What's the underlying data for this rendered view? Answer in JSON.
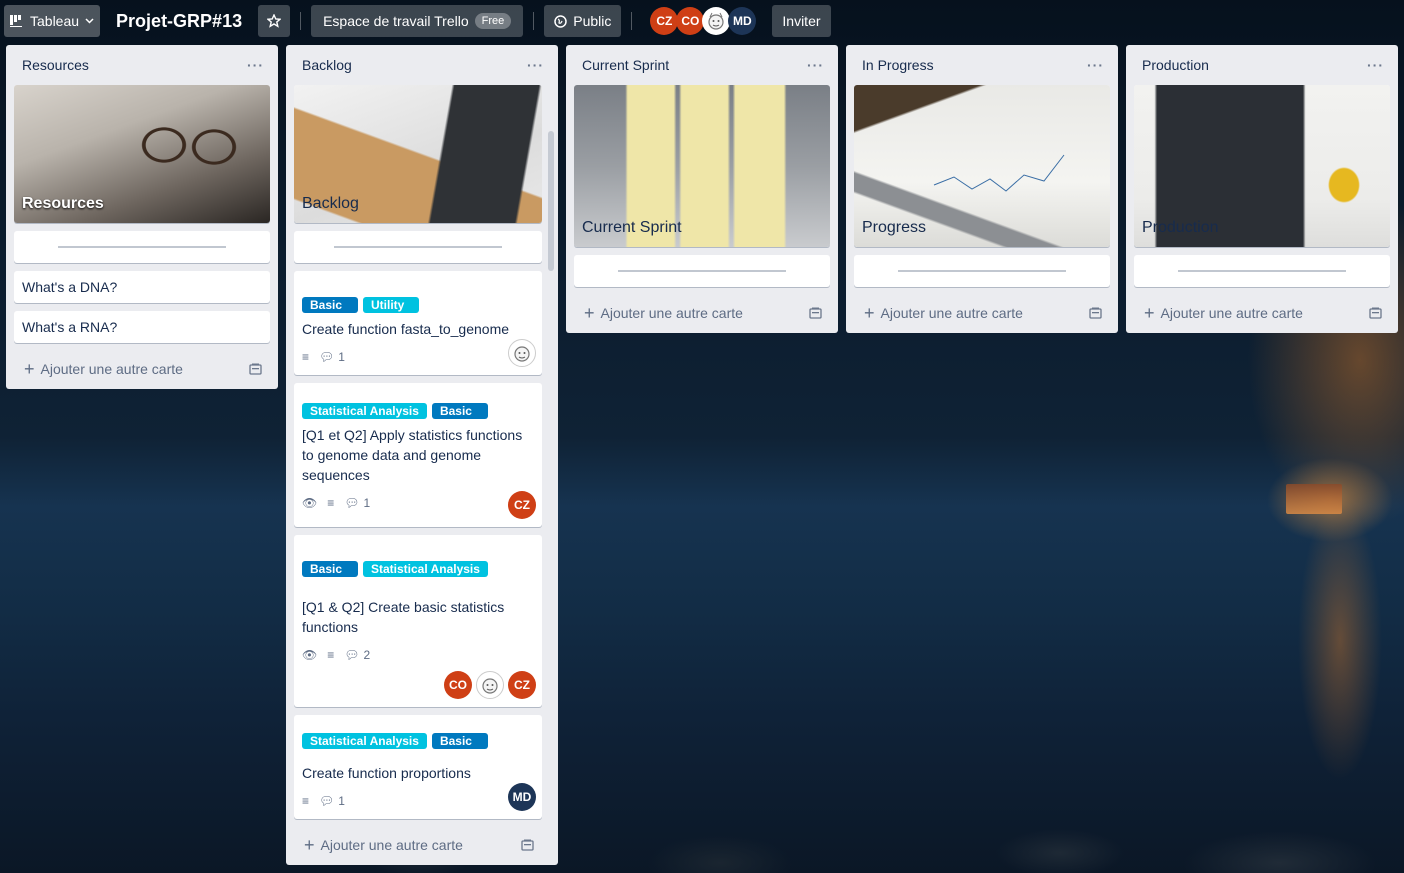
{
  "header": {
    "board_menu_label": "Tableau",
    "board_title": "Projet-GRP#13",
    "workspace_label": "Espace de travail Trello",
    "workspace_badge": "Free",
    "visibility_label": "Public",
    "members": [
      "CZ",
      "CO",
      "",
      "MD"
    ],
    "invite_label": "Inviter"
  },
  "add_card_label": "Ajouter une autre carte",
  "lists": [
    {
      "title": "Resources",
      "cover_title": "Resources",
      "cards": [
        {
          "title": "What's a DNA?"
        },
        {
          "title": "What's a RNA?"
        }
      ]
    },
    {
      "title": "Backlog",
      "cover_title": "Backlog",
      "cards": [
        {
          "labels": [
            "Basic",
            "Utility"
          ],
          "title": "Create function fasta_to_genome",
          "comments": "1",
          "members": [
            ""
          ]
        },
        {
          "labels": [
            "Statistical Analysis",
            "Basic"
          ],
          "title": "[Q1 et Q2] Apply statistics functions to genome data and genome sequences",
          "comments": "1",
          "members": [
            "CZ"
          ]
        },
        {
          "labels": [
            "Basic",
            "Statistical Analysis"
          ],
          "title": "[Q1 & Q2] Create basic statistics functions",
          "comments": "2",
          "members": [
            "CO",
            "",
            "CZ"
          ]
        },
        {
          "labels": [
            "Statistical Analysis",
            "Basic"
          ],
          "title": "Create function proportions",
          "comments": "1",
          "members": [
            "MD"
          ]
        }
      ]
    },
    {
      "title": "Current Sprint",
      "cover_title": "Current Sprint"
    },
    {
      "title": "In Progress",
      "cover_title": "Progress"
    },
    {
      "title": "Production",
      "cover_title": "Production"
    }
  ],
  "colors": {
    "label_basic": "#0079bf",
    "label_teal": "#00c2e0",
    "avatar_red": "#cf3f15",
    "avatar_navy": "#1d3557",
    "list_bg": "#ebecf0"
  }
}
